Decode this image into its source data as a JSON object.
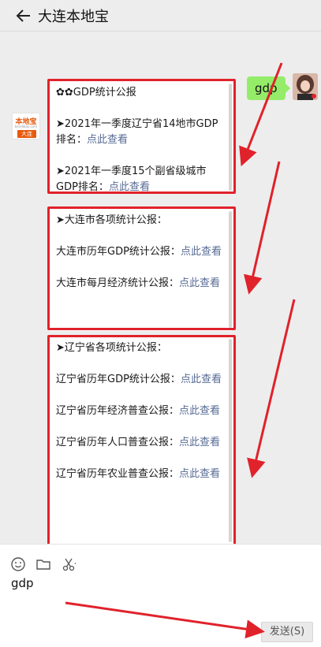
{
  "header": {
    "title": "大连本地宝"
  },
  "user_message": {
    "text": "gdp"
  },
  "oa_logo": {
    "top": "本地宝",
    "mid": "bendibao.com",
    "bottom": "大连"
  },
  "messages": [
    {
      "lines": [
        {
          "text": "✿✿GDP统计公报"
        },
        {
          "text": ""
        },
        {
          "text": "➤2021年一季度辽宁省14地市GDP排名：",
          "link": "点此查看"
        },
        {
          "text": ""
        },
        {
          "text": "➤2021年一季度15个副省级城市GDP排名：",
          "link": "点此查看"
        }
      ]
    },
    {
      "lines": [
        {
          "text": "➤大连市各项统计公报："
        },
        {
          "text": ""
        },
        {
          "text": "大连市历年GDP统计公报：",
          "link": "点此查看"
        },
        {
          "text": ""
        },
        {
          "text": "大连市每月经济统计公报：",
          "link": "点此查看"
        }
      ]
    },
    {
      "lines": [
        {
          "text": "➤辽宁省各项统计公报："
        },
        {
          "text": ""
        },
        {
          "text": "辽宁省历年GDP统计公报：",
          "link": "点此查看"
        },
        {
          "text": ""
        },
        {
          "text": "辽宁省历年经济普查公报：",
          "link": "点此查看"
        },
        {
          "text": ""
        },
        {
          "text": "辽宁省历年人口普查公报：",
          "link": "点此查看"
        },
        {
          "text": ""
        },
        {
          "text": "辽宁省历年农业普查公报：",
          "link": "点此查看"
        }
      ]
    }
  ],
  "input": {
    "value": "gdp"
  },
  "send_button": {
    "label": "发送(S)"
  },
  "toolbar": {
    "icons": [
      "emoji-icon",
      "folder-icon",
      "scissors-icon"
    ]
  },
  "colors": {
    "bubble_green": "#95ec69",
    "link_blue": "#576b95",
    "annotation_red": "#e0222b"
  }
}
